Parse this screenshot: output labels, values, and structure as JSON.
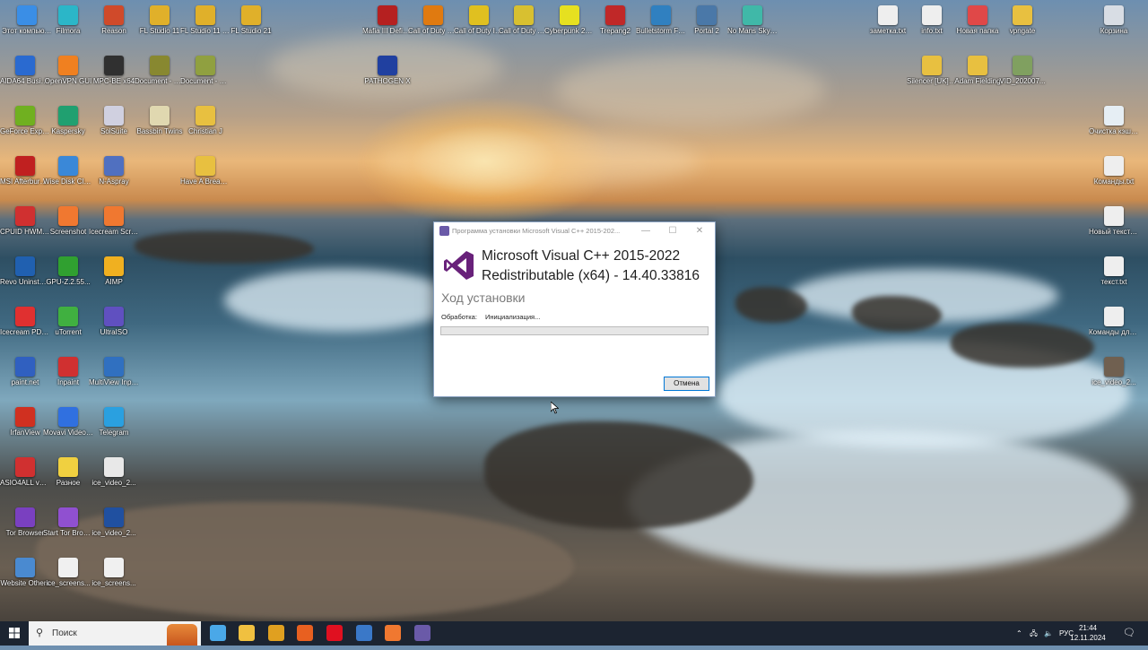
{
  "wallpaper": "seascape-sunset",
  "desktop_icons": [
    {
      "label": "Этот компьютер",
      "color": "#3a8ee6"
    },
    {
      "label": "Filmora",
      "color": "#2bb6c8"
    },
    {
      "label": "Reason",
      "color": "#d04a2a"
    },
    {
      "label": "FL Studio 11",
      "color": "#e0b02a"
    },
    {
      "label": "FL Studio 11 (64bit)",
      "color": "#e0b02a"
    },
    {
      "label": "FL Studio 21",
      "color": "#e0b02a"
    },
    {
      "label": "Mafia III Definiti...",
      "color": "#b52020"
    },
    {
      "label": "Call of Duty Black Ops III",
      "color": "#e07a10"
    },
    {
      "label": "Call of Duty Infinite W...",
      "color": "#e0c020"
    },
    {
      "label": "Call of Duty Advanced ...",
      "color": "#d8c030"
    },
    {
      "label": "Cyberpunk 2077",
      "color": "#e6e020"
    },
    {
      "label": "Trepang2",
      "color": "#c02828"
    },
    {
      "label": "Bulletstorm Full Clip E...",
      "color": "#3080c0"
    },
    {
      "label": "Portal 2",
      "color": "#4a78a8"
    },
    {
      "label": "No Mans Sky [7L]",
      "color": "#40b8a8"
    },
    {
      "label": "заметка.txt",
      "color": "#eeeeee"
    },
    {
      "label": "info.txt",
      "color": "#eeeeee"
    },
    {
      "label": "Новая папка",
      "color": "#e04848"
    },
    {
      "label": "vpngate",
      "color": "#e8c040"
    },
    {
      "label": "Корзина",
      "color": "#d8dde4"
    },
    {
      "label": "AIDA64 Business",
      "color": "#2a6ad0"
    },
    {
      "label": "OpenVPN GUI",
      "color": "#f08020"
    },
    {
      "label": "MPC-BE x64",
      "color": "#303030"
    },
    {
      "label": "Document - 8ms",
      "color": "#888830"
    },
    {
      "label": "Document - Saved",
      "color": "#90a040"
    },
    {
      "label": "PATHOGEN X",
      "color": "#2040a0"
    },
    {
      "label": "Silencer [UK] - Signals (2...",
      "color": "#e8c040"
    },
    {
      "label": "Adam Fielding",
      "color": "#e8c040"
    },
    {
      "label": "VID_202007...",
      "color": "#80a060"
    },
    {
      "label": "GeForce Experience",
      "color": "#70b020"
    },
    {
      "label": "Kaspersky",
      "color": "#20a070"
    },
    {
      "label": "SolSuite",
      "color": "#d0d0e0"
    },
    {
      "label": "Bassbin Twins",
      "color": "#e0d8b0"
    },
    {
      "label": "Christian J",
      "color": "#e8c040"
    },
    {
      "label": "Очистка кэша обно...",
      "color": "#e6eef4"
    },
    {
      "label": "MSI Afterburner",
      "color": "#c02020"
    },
    {
      "label": "Wise Disk Cleaner",
      "color": "#3a88d8"
    },
    {
      "label": "N-Aspray",
      "color": "#5070c0"
    },
    {
      "label": "Have A Break 04 (Mixed ...",
      "color": "#e8c040"
    },
    {
      "label": "Команды.txt",
      "color": "#eeeeee"
    },
    {
      "label": "CPUID HWMonitor",
      "color": "#d03030"
    },
    {
      "label": "Screenshot",
      "color": "#f07830"
    },
    {
      "label": "Icecream Screen ...",
      "color": "#f07830"
    },
    {
      "label": "Новый текстовый ...",
      "color": "#eeeeee"
    },
    {
      "label": "Revo Uninstall...",
      "color": "#2060b0"
    },
    {
      "label": "GPU-Z.2.55...",
      "color": "#30a030"
    },
    {
      "label": "AIMP",
      "color": "#f0b020"
    },
    {
      "label": "текст.txt",
      "color": "#eeeeee"
    },
    {
      "label": "Icecream PDF Editor",
      "color": "#e03030"
    },
    {
      "label": "uTorrent",
      "color": "#40b040"
    },
    {
      "label": "UltraISO",
      "color": "#6050c0"
    },
    {
      "label": "Команды для очистк...",
      "color": "#eeeeee"
    },
    {
      "label": "paint.net",
      "color": "#3060c0"
    },
    {
      "label": "Inpaint",
      "color": "#d03030"
    },
    {
      "label": "MultiView Inpaint",
      "color": "#3070c0"
    },
    {
      "label": "ice_video_2...",
      "color": "#706050"
    },
    {
      "label": "IrfanView",
      "color": "#d03020"
    },
    {
      "label": "Movavi Video Converter",
      "color": "#3070e0"
    },
    {
      "label": "Telegram",
      "color": "#2aa0e0"
    },
    {
      "label": "ASIO4ALL v2 Instruction...",
      "color": "#d03030"
    },
    {
      "label": "Разное",
      "color": "#f0d040"
    },
    {
      "label": "ice_video_2...",
      "color": "#e8e8e8"
    },
    {
      "label": "Tor Browser",
      "color": "#7a40c0"
    },
    {
      "label": "Start Tor Browser",
      "color": "#9050d0"
    },
    {
      "label": "ice_video_2...",
      "color": "#2050a0"
    },
    {
      "label": "Website Others",
      "color": "#4a8ad0"
    },
    {
      "label": "ice_screens...",
      "color": "#f0f0f0"
    },
    {
      "label": "ice_screens...",
      "color": "#f0f0f0"
    }
  ],
  "dialog": {
    "title": "Программа установки Microsoft Visual C++ 2015-202...",
    "minimize_label": "—",
    "maximize_label": "☐",
    "close_label": "✕",
    "product_line1": "Microsoft Visual C++ 2015-2022",
    "product_line2": "Redistributable (x64) - 14.40.33816",
    "heading": "Ход установки",
    "processing_label": "Обработка:",
    "processing_value": "Инициализация...",
    "progress": 0,
    "cancel_label": "Отмена",
    "logo_color": "#68217a"
  },
  "taskbar": {
    "search_placeholder": "Поиск",
    "apps": [
      {
        "name": "task-view",
        "color": "#4aa8e8"
      },
      {
        "name": "explorer",
        "color": "#f0c040"
      },
      {
        "name": "chrome",
        "color": "#e0a020"
      },
      {
        "name": "firefox",
        "color": "#e86020"
      },
      {
        "name": "opera",
        "color": "#e01020"
      },
      {
        "name": "app-blue",
        "color": "#3a78c8"
      },
      {
        "name": "screenshot",
        "color": "#f07830"
      },
      {
        "name": "installer",
        "color": "#6a5aa8"
      }
    ],
    "language": "РУС",
    "time": "21:44",
    "date": "12.11.2024"
  }
}
